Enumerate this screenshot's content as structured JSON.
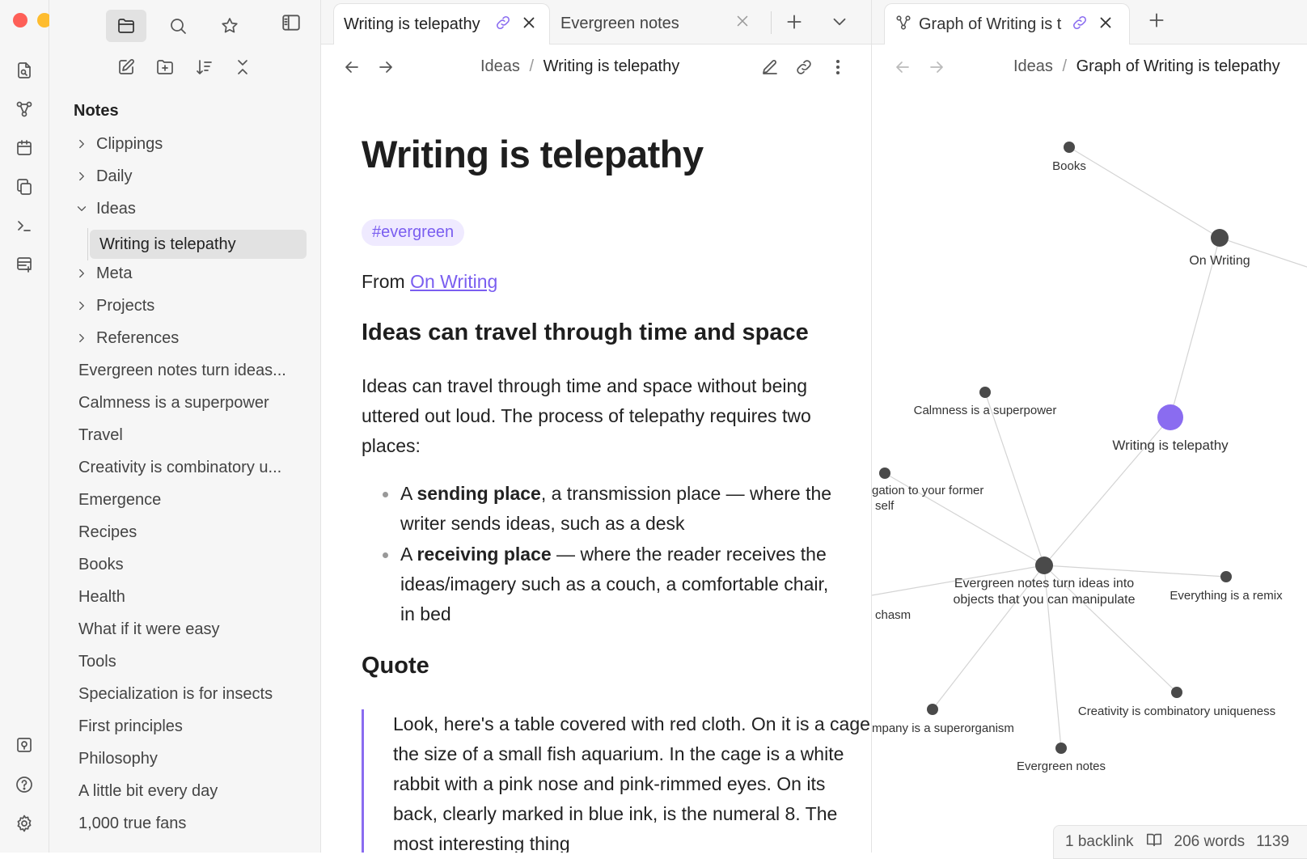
{
  "ribbon": {
    "icons": [
      "files-icon",
      "graph-icon",
      "calendar-icon",
      "copy-icon",
      "terminal-icon",
      "canvas-icon",
      "vault-icon",
      "help-icon",
      "settings-icon"
    ]
  },
  "sidebar": {
    "title": "Notes",
    "folders": [
      {
        "label": "Clippings",
        "expanded": false
      },
      {
        "label": "Daily",
        "expanded": false
      },
      {
        "label": "Ideas",
        "expanded": true
      },
      {
        "label": "Meta",
        "expanded": false
      },
      {
        "label": "Projects",
        "expanded": false
      },
      {
        "label": "References",
        "expanded": false
      }
    ],
    "selected_note": "Writing is telepathy",
    "notes": [
      "Evergreen notes turn ideas...",
      "Calmness is a superpower",
      "Travel",
      "Creativity is combinatory u...",
      "Emergence",
      "Recipes",
      "Books",
      "Health",
      "What if it were easy",
      "Tools",
      "Specialization is for insects",
      "First principles",
      "Philosophy",
      "A little bit every day",
      "1,000 true fans"
    ]
  },
  "tabs": {
    "tab1": "Writing is telepathy",
    "tab2": "Evergreen notes",
    "tab3": "Graph of Writing is t"
  },
  "note": {
    "breadcrumb_folder": "Ideas",
    "breadcrumb_sep": "/",
    "breadcrumb_note": "Writing is telepathy",
    "title": "Writing is telepathy",
    "tag": "#evergreen",
    "from_prefix": "From",
    "from_link": "On Writing",
    "h2": "Ideas can travel through time and space",
    "para": "Ideas can travel through time and space without being uttered out loud. The process of telepathy requires two places:",
    "bullet1": {
      "pre": "A",
      "bold": "sending place",
      "post": ", a transmission place — where the writer sends ideas, such as a desk"
    },
    "bullet2": {
      "pre": "A",
      "bold": "receiving place",
      "post": " — where the reader receives the ideas/imagery such as a couch, a comfortable chair, in bed"
    },
    "quote_heading": "Quote",
    "quote": "Look, here's a table covered with red cloth. On it is a cage the size of a small fish aquarium. In the cage is a white rabbit with a pink nose and pink-rimmed eyes. On its back, clearly marked in blue ink, is the numeral 8. The most interesting thing"
  },
  "graph": {
    "breadcrumb_folder": "Ideas",
    "breadcrumb_sep": "/",
    "breadcrumb_note": "Graph of Writing is telepathy",
    "accent_color": "#8a6cf0",
    "node_color": "#4a4a4a",
    "nodes": {
      "books": "Books",
      "on_writing": "On Writing",
      "writing": "Writing is telepathy",
      "calmness": "Calmness is a superpower",
      "obligation_1": "gation to your former",
      "obligation_2": "self",
      "evergreen_turn_1": "Evergreen notes turn ideas into",
      "evergreen_turn_2": "objects that you can manipulate",
      "remix": "Everything is a remix",
      "chasm": "chasm",
      "company": "mpany is a superorganism",
      "creativity": "Creativity is combinatory uniqueness",
      "evergreen": "Evergreen notes"
    }
  },
  "status": {
    "backlinks": "1 backlink",
    "words": "206 words",
    "chars": "1139"
  }
}
